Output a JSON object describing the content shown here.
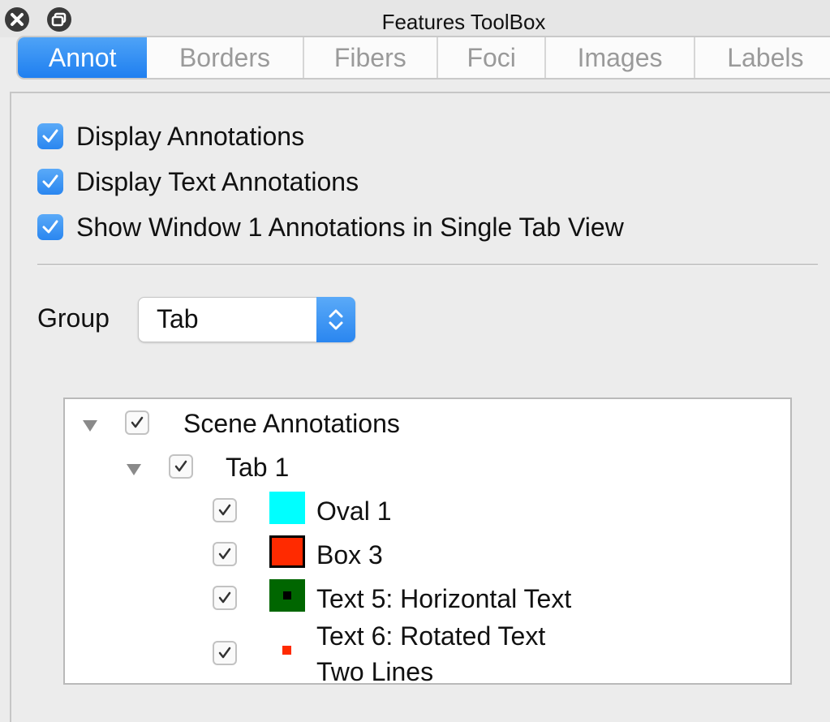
{
  "window": {
    "title": "Features ToolBox"
  },
  "tabs": [
    {
      "label": "Annot",
      "active": true
    },
    {
      "label": "Borders",
      "active": false
    },
    {
      "label": "Fibers",
      "active": false
    },
    {
      "label": "Foci",
      "active": false
    },
    {
      "label": "Images",
      "active": false
    },
    {
      "label": "Labels",
      "active": false
    }
  ],
  "options": [
    {
      "label": "Display Annotations",
      "checked": true
    },
    {
      "label": "Display Text Annotations",
      "checked": true
    },
    {
      "label": "Show Window 1 Annotations in Single Tab View",
      "checked": true
    }
  ],
  "group": {
    "label": "Group",
    "value": "Tab"
  },
  "tree": {
    "root": {
      "label": "Scene Annotations",
      "checked": true,
      "expanded": true
    },
    "tab": {
      "label": "Tab 1",
      "checked": true,
      "expanded": true
    },
    "items": [
      {
        "label": "Oval 1",
        "checked": true,
        "swatch": "#00ffff",
        "swatch_icon": "cyan-fill"
      },
      {
        "label": "Box 3",
        "checked": true,
        "swatch": "#ff2a00",
        "swatch_icon": "red-fill-black-border"
      },
      {
        "label": "Text 5: Horizontal Text",
        "checked": true,
        "swatch": "#006600",
        "swatch_icon": "green-fill-black-square"
      },
      {
        "label_line1": "Text 6: Rotated Text",
        "label_line2": "Two Lines",
        "checked": true,
        "swatch": "#ff2a00",
        "swatch_icon": "small-red-square"
      }
    ]
  },
  "colors": {
    "accent": "#2a86f0",
    "tree_background": "#ffffff",
    "window_background": "#ececec"
  }
}
